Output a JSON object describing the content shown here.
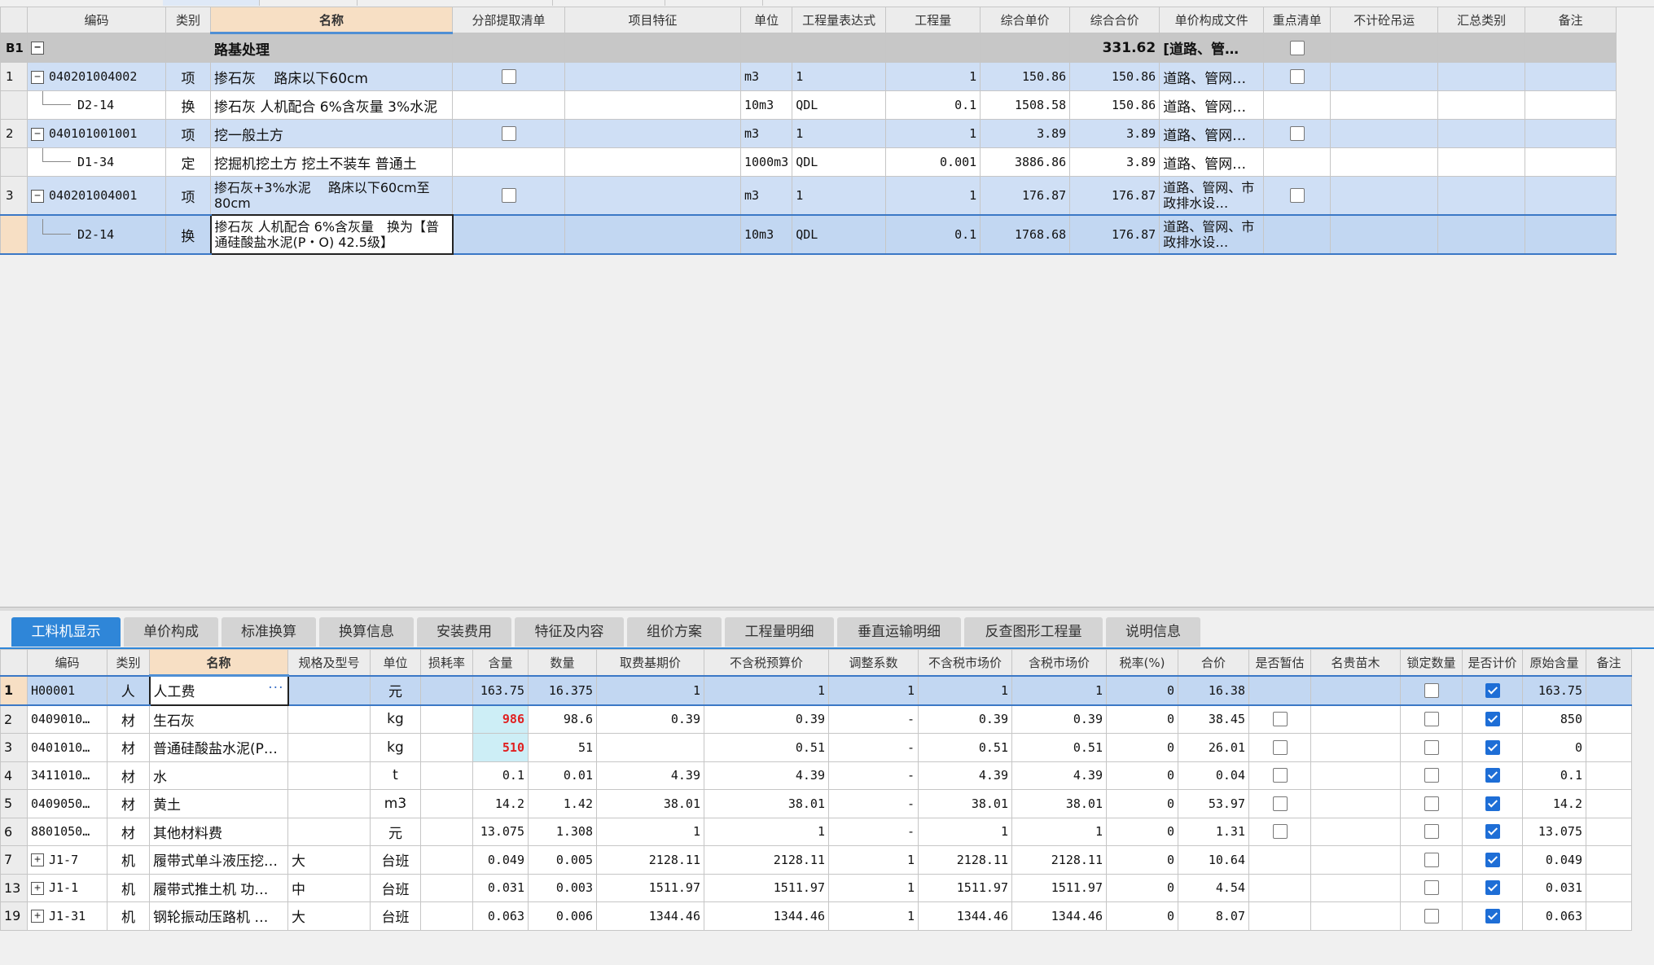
{
  "colors": {
    "accent": "#2f86d8",
    "header_highlight": "#f7dfc4",
    "row_item": "#cfdff5",
    "row_group": "#c7c7c7",
    "red_value": "#e02020",
    "cyan_cell": "#cdeef6"
  },
  "top": {
    "headers": {
      "code": "编码",
      "type": "类别",
      "name": "名称",
      "fenbu": "分部提取清单",
      "feature": "项目特征",
      "unit": "单位",
      "expr": "工程量表达式",
      "qty": "工程量",
      "unit_price": "综合单价",
      "total_price": "综合合价",
      "price_file": "单价构成文件",
      "key": "重点清单",
      "crane": "不计砼吊运",
      "summary": "汇总类别",
      "remark": "备注"
    },
    "group": {
      "label": "B1",
      "name": "路基处理",
      "total_price": "331.62",
      "price_file": "[道路、管…"
    },
    "rows": [
      {
        "rownum": "1",
        "code": "040201004002",
        "type": "项",
        "name": "掺石灰　 路床以下60cm",
        "unit": "m3",
        "expr": "1",
        "qty": "1",
        "unit_price": "150.86",
        "total_price": "150.86",
        "price_file": "道路、管网…"
      },
      {
        "rownum": "",
        "code": "D2-14",
        "type": "换",
        "name": "掺石灰 人机配合 6%含灰量 3%水泥",
        "unit": "10m3",
        "expr": "QDL",
        "qty": "0.1",
        "unit_price": "1508.58",
        "total_price": "150.86",
        "price_file": "道路、管网…"
      },
      {
        "rownum": "2",
        "code": "040101001001",
        "type": "项",
        "name": "挖一般土方",
        "unit": "m3",
        "expr": "1",
        "qty": "1",
        "unit_price": "3.89",
        "total_price": "3.89",
        "price_file": "道路、管网…"
      },
      {
        "rownum": "",
        "code": "D1-34",
        "type": "定",
        "name": "挖掘机挖土方 挖土不装车 普通土",
        "unit": "1000m3",
        "expr": "QDL",
        "qty": "0.001",
        "unit_price": "3886.86",
        "total_price": "3.89",
        "price_file": "道路、管网…"
      },
      {
        "rownum": "3",
        "code": "040201004001",
        "type": "项",
        "name": "掺石灰+3%水泥　 路床以下60cm至80cm",
        "unit": "m3",
        "expr": "1",
        "qty": "1",
        "unit_price": "176.87",
        "total_price": "176.87",
        "price_file": "道路、管网、市政排水设…"
      },
      {
        "rownum": "",
        "code": "D2-14",
        "type": "换",
        "name": "掺石灰 人机配合 6%含灰量　换为【普通硅酸盐水泥(P・O) 42.5级】",
        "unit": "10m3",
        "expr": "QDL",
        "qty": "0.1",
        "unit_price": "1768.68",
        "total_price": "176.87",
        "price_file": "道路、管网、市政排水设…"
      }
    ]
  },
  "tabs": [
    "工料机显示",
    "单价构成",
    "标准换算",
    "换算信息",
    "安装费用",
    "特征及内容",
    "组价方案",
    "工程量明细",
    "垂直运输明细",
    "反查图形工程量",
    "说明信息"
  ],
  "bottom": {
    "headers": {
      "code": "编码",
      "type": "类别",
      "name": "名称",
      "spec": "规格及型号",
      "unit": "单位",
      "loss": "损耗率",
      "content": "含量",
      "amount": "数量",
      "base_price": "取费基期价",
      "budget_price": "不含税预算价",
      "adj": "调整系数",
      "market_price": "不含税市场价",
      "market_tax_price": "含税市场价",
      "tax": "税率(%)",
      "total": "合价",
      "provisional": "是否暂估",
      "seedling": "名贵苗木",
      "lock_qty": "锁定数量",
      "priced": "是否计价",
      "orig_content": "原始含量",
      "remark": "备注"
    },
    "rows": [
      {
        "rownum": "1",
        "code": "H00001",
        "type": "人",
        "name": "人工费",
        "spec": "",
        "unit": "元",
        "loss": "",
        "content": "163.75",
        "amount": "16.375",
        "base_price": "1",
        "budget_price": "1",
        "adj": "1",
        "market_price": "1",
        "market_tax_price": "1",
        "tax": "0",
        "total": "16.38",
        "orig_content": "163.75"
      },
      {
        "rownum": "2",
        "code": "0409010…",
        "type": "材",
        "name": "生石灰",
        "spec": "",
        "unit": "kg",
        "loss": "",
        "content": "986",
        "amount": "98.6",
        "base_price": "0.39",
        "budget_price": "0.39",
        "adj": "-",
        "market_price": "0.39",
        "market_tax_price": "0.39",
        "tax": "0",
        "total": "38.45",
        "orig_content": "850"
      },
      {
        "rownum": "3",
        "code": "0401010…",
        "type": "材",
        "name": "普通硅酸盐水泥(P…",
        "spec": "",
        "unit": "kg",
        "loss": "",
        "content": "510",
        "amount": "51",
        "base_price": "",
        "budget_price": "0.51",
        "adj": "-",
        "market_price": "0.51",
        "market_tax_price": "0.51",
        "tax": "0",
        "total": "26.01",
        "orig_content": "0"
      },
      {
        "rownum": "4",
        "code": "3411010…",
        "type": "材",
        "name": "水",
        "spec": "",
        "unit": "t",
        "loss": "",
        "content": "0.1",
        "amount": "0.01",
        "base_price": "4.39",
        "budget_price": "4.39",
        "adj": "-",
        "market_price": "4.39",
        "market_tax_price": "4.39",
        "tax": "0",
        "total": "0.04",
        "orig_content": "0.1"
      },
      {
        "rownum": "5",
        "code": "0409050…",
        "type": "材",
        "name": "黄土",
        "spec": "",
        "unit": "m3",
        "loss": "",
        "content": "14.2",
        "amount": "1.42",
        "base_price": "38.01",
        "budget_price": "38.01",
        "adj": "-",
        "market_price": "38.01",
        "market_tax_price": "38.01",
        "tax": "0",
        "total": "53.97",
        "orig_content": "14.2"
      },
      {
        "rownum": "6",
        "code": "8801050…",
        "type": "材",
        "name": "其他材料费",
        "spec": "",
        "unit": "元",
        "loss": "",
        "content": "13.075",
        "amount": "1.308",
        "base_price": "1",
        "budget_price": "1",
        "adj": "-",
        "market_price": "1",
        "market_tax_price": "1",
        "tax": "0",
        "total": "1.31",
        "orig_content": "13.075"
      },
      {
        "rownum": "7",
        "code": "J1-7",
        "type": "机",
        "name": "履带式单斗液压挖…",
        "spec": "大",
        "unit": "台班",
        "loss": "",
        "content": "0.049",
        "amount": "0.005",
        "base_price": "2128.11",
        "budget_price": "2128.11",
        "adj": "1",
        "market_price": "2128.11",
        "market_tax_price": "2128.11",
        "tax": "0",
        "total": "10.64",
        "orig_content": "0.049"
      },
      {
        "rownum": "13",
        "code": "J1-1",
        "type": "机",
        "name": "履带式推土机 功…",
        "spec": "中",
        "unit": "台班",
        "loss": "",
        "content": "0.031",
        "amount": "0.003",
        "base_price": "1511.97",
        "budget_price": "1511.97",
        "adj": "1",
        "market_price": "1511.97",
        "market_tax_price": "1511.97",
        "tax": "0",
        "total": "4.54",
        "orig_content": "0.031"
      },
      {
        "rownum": "19",
        "code": "J1-31",
        "type": "机",
        "name": "钢轮振动压路机 …",
        "spec": "大",
        "unit": "台班",
        "loss": "",
        "content": "0.063",
        "amount": "0.006",
        "base_price": "1344.46",
        "budget_price": "1344.46",
        "adj": "1",
        "market_price": "1344.46",
        "market_tax_price": "1344.46",
        "tax": "0",
        "total": "8.07",
        "orig_content": "0.063"
      }
    ]
  }
}
